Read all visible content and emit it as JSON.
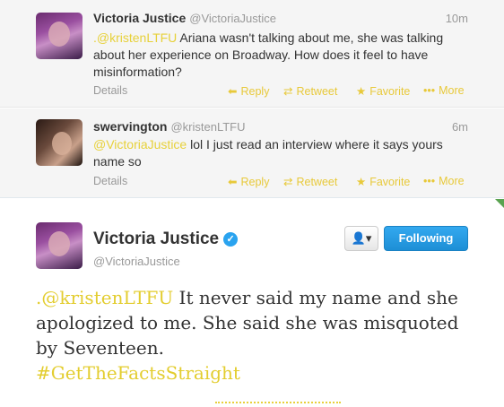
{
  "replies": [
    {
      "name": "Victoria Justice",
      "handle": "@VictoriaJustice",
      "time": "10m",
      "mention": ".@kristenLTFU",
      "text": " Ariana wasn't talking about me, she was talking about her experience on Broadway. How does it feel to have misinformation?",
      "details": "Details",
      "reply": "Reply",
      "retweet": "Retweet",
      "favorite": "Favorite",
      "more": "More"
    },
    {
      "name": "swervington",
      "handle": "@kristenLTFU",
      "time": "6m",
      "mention": "@VictoriaJustice",
      "text": " lol I just read an interview where it says yours name so",
      "details": "Details",
      "reply": "Reply",
      "retweet": "Retweet",
      "favorite": "Favorite",
      "more": "More"
    }
  ],
  "main": {
    "name": "Victoria Justice",
    "handle": "@VictoriaJustice",
    "follow_label": "Following",
    "user_menu_icon": "👤▾",
    "mention": ".@kristenLTFU",
    "text": " It never said my name and she apologized to me. She said she was misquoted by Seventeen.",
    "hashtag": "#GetTheFactsStraight"
  },
  "icons": {
    "reply": "reply-arrow-icon",
    "retweet": "retweet-icon",
    "favorite": "star-icon",
    "more": "more-dots-icon",
    "verified": "verified-check-icon"
  },
  "colors": {
    "link": "#e7d13a",
    "following_button": "#2aa3ef",
    "verified": "#2aa3ef"
  }
}
